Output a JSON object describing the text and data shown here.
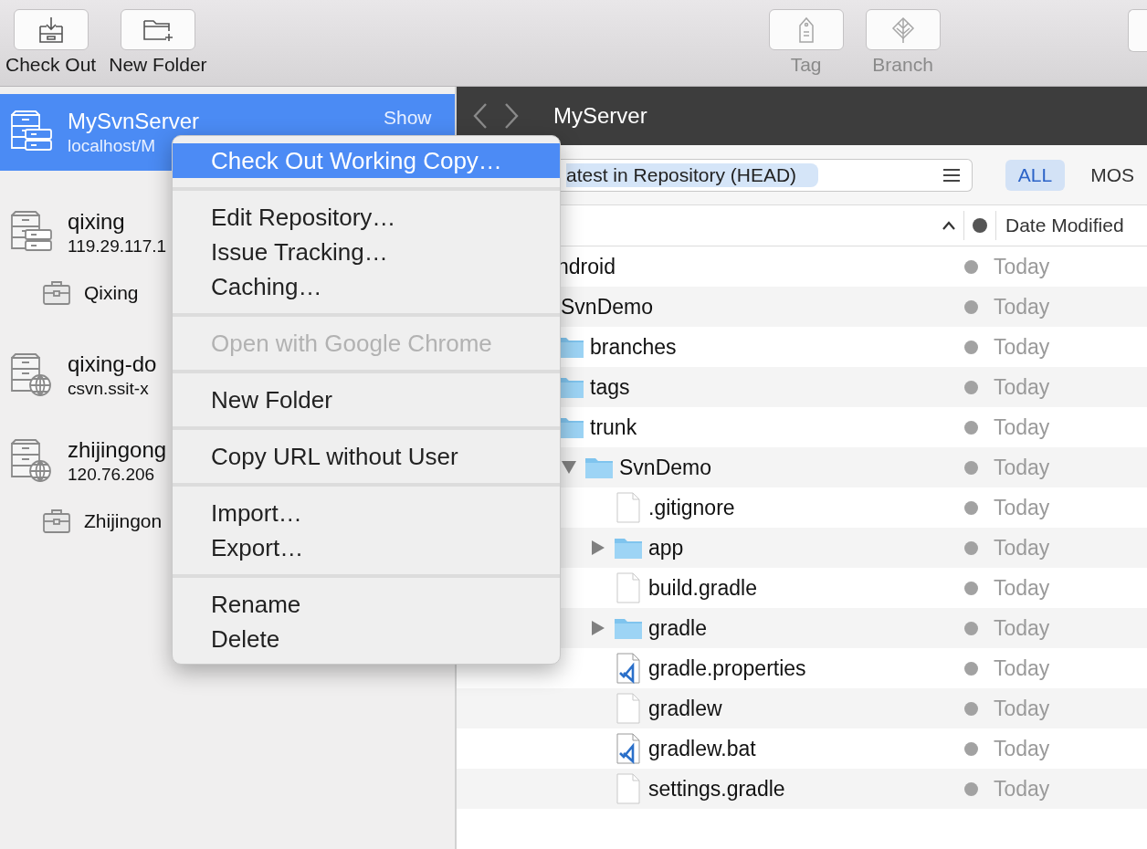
{
  "toolbar": {
    "left_buttons": [
      {
        "label": "Check Out",
        "kind": "checkout",
        "disabled": false
      },
      {
        "label": "New Folder",
        "kind": "new-folder",
        "disabled": false
      }
    ],
    "right_buttons": [
      {
        "label": "Tag",
        "kind": "tag",
        "disabled": true
      },
      {
        "label": "Branch",
        "kind": "branch",
        "disabled": true
      }
    ]
  },
  "sidebar": {
    "items": [
      {
        "name": "MySvnServer",
        "address": "localhost/M",
        "kind": "local",
        "selected": true,
        "action": "Show"
      },
      {
        "name": "qixing",
        "address": "119.29.117.1",
        "kind": "local",
        "selected": false,
        "children": [
          {
            "name": "Qixing",
            "selected": false
          }
        ]
      },
      {
        "name": "qixing-do",
        "address": "csvn.ssit-x",
        "kind": "remote",
        "selected": false
      },
      {
        "name": "zhijingong",
        "address": "120.76.206",
        "kind": "remote",
        "selected": false,
        "children": [
          {
            "name": "Zhijingon",
            "selected": false
          }
        ]
      }
    ]
  },
  "browser": {
    "title": "MyServer",
    "revision": "atest in Repository (HEAD)",
    "filters": [
      {
        "label": "ALL",
        "selected": true
      },
      {
        "label": "MOS",
        "selected": false
      }
    ],
    "date_column": "Date Modified",
    "tree": [
      {
        "name": "ndroid",
        "date": "Today",
        "children": [
          {
            "name": "SvnDemo",
            "date": "Today",
            "children": [
              {
                "name": "branches",
                "kind": "folder",
                "date": "Today"
              },
              {
                "name": "tags",
                "kind": "folder",
                "date": "Today"
              },
              {
                "name": "trunk",
                "kind": "folder",
                "date": "Today",
                "children": [
                  {
                    "name": "SvnDemo",
                    "kind": "folder",
                    "date": "Today",
                    "expanded": true,
                    "children": [
                      {
                        "name": ".gitignore",
                        "kind": "file",
                        "date": "Today"
                      },
                      {
                        "name": "app",
                        "kind": "folder",
                        "date": "Today",
                        "expanded": false
                      },
                      {
                        "name": "build.gradle",
                        "kind": "file",
                        "date": "Today"
                      },
                      {
                        "name": "gradle",
                        "kind": "folder",
                        "date": "Today",
                        "expanded": false
                      },
                      {
                        "name": "gradle.properties",
                        "kind": "code-file",
                        "date": "Today"
                      },
                      {
                        "name": "gradlew",
                        "kind": "file",
                        "date": "Today"
                      },
                      {
                        "name": "gradlew.bat",
                        "kind": "code-file",
                        "date": "Today"
                      },
                      {
                        "name": "settings.gradle",
                        "kind": "file",
                        "date": "Today"
                      }
                    ]
                  }
                ]
              }
            ]
          }
        ]
      }
    ]
  },
  "context_menu": {
    "groups": [
      [
        {
          "label": "Check Out Working Copy…",
          "selected": true,
          "disabled": false
        }
      ],
      [
        {
          "label": "Edit Repository…",
          "selected": false,
          "disabled": false
        },
        {
          "label": "Issue Tracking…",
          "selected": false,
          "disabled": false
        },
        {
          "label": "Caching…",
          "selected": false,
          "disabled": false
        }
      ],
      [
        {
          "label": "Open with Google Chrome",
          "selected": false,
          "disabled": true
        }
      ],
      [
        {
          "label": "New Folder",
          "selected": false,
          "disabled": false
        }
      ],
      [
        {
          "label": "Copy URL without User",
          "selected": false,
          "disabled": false
        }
      ],
      [
        {
          "label": "Import…",
          "selected": false,
          "disabled": false
        },
        {
          "label": "Export…",
          "selected": false,
          "disabled": false
        }
      ],
      [
        {
          "label": "Rename",
          "selected": false,
          "disabled": false
        },
        {
          "label": "Delete",
          "selected": false,
          "disabled": false
        }
      ]
    ]
  }
}
